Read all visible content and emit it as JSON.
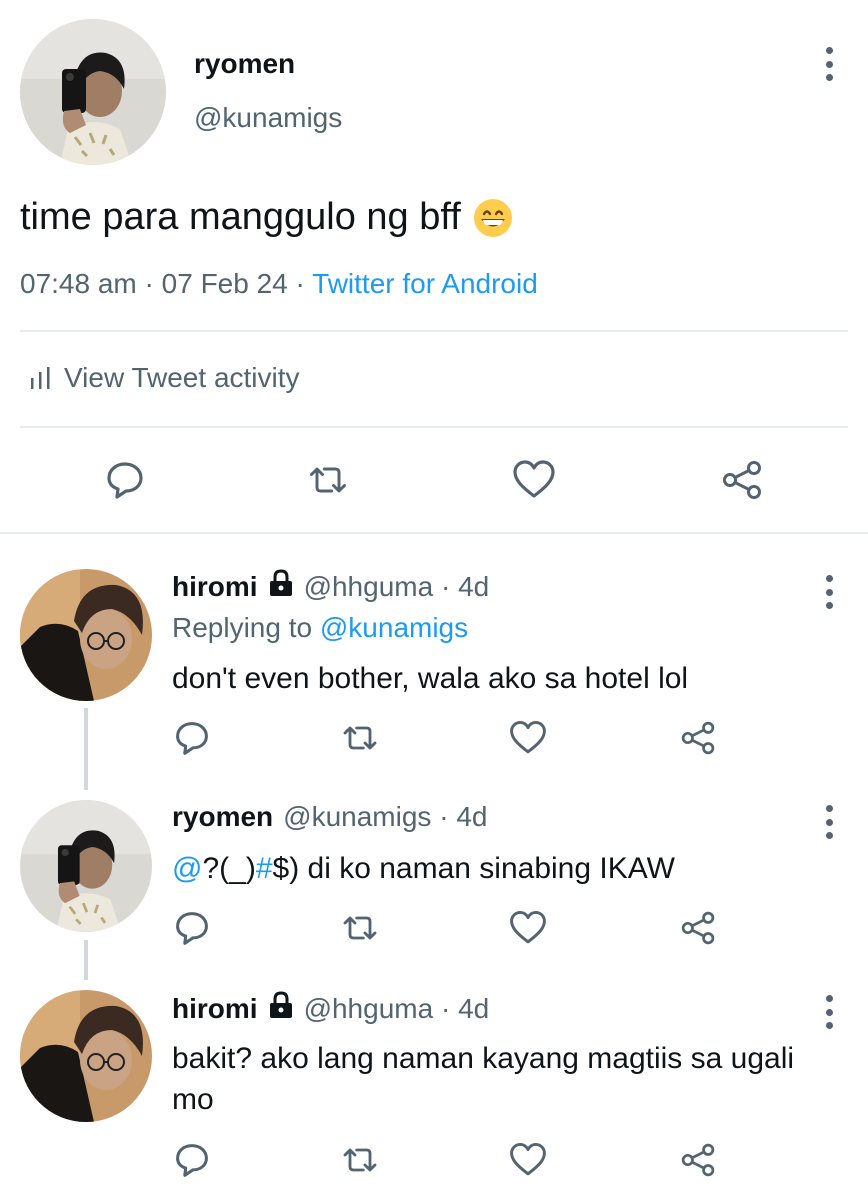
{
  "main_tweet": {
    "display_name": "ryomen",
    "handle": "@kunamigs",
    "text": "time para manggulo ng bff",
    "emoji": "grinning-face-with-smiling-eyes",
    "time": "07:48 am",
    "date": "07 Feb 24",
    "source": "Twitter for Android",
    "view_activity_label": "View Tweet activity"
  },
  "replies": [
    {
      "display_name": "hiromi",
      "handle": "@hhguma",
      "age": "4d",
      "protected": true,
      "replying_to_prefix": "Replying to",
      "replying_to": "@kunamigs",
      "text": "don't even bother, wala ako sa hotel lol"
    },
    {
      "display_name": "ryomen",
      "handle": "@kunamigs",
      "age": "4d",
      "protected": false,
      "text_parts": [
        "@",
        "?(_)",
        "#",
        "$) di ko naman sinabing IKAW"
      ]
    },
    {
      "display_name": "hiromi",
      "handle": "@hhguma",
      "age": "4d",
      "protected": true,
      "text": "bakit? ako lang naman kayang magtiis sa ugali mo"
    }
  ],
  "separator": " · ",
  "colors": {
    "text": "#0f1419",
    "secondary": "#536471",
    "link": "#1d9bf0",
    "divider": "#e6ecf0"
  }
}
